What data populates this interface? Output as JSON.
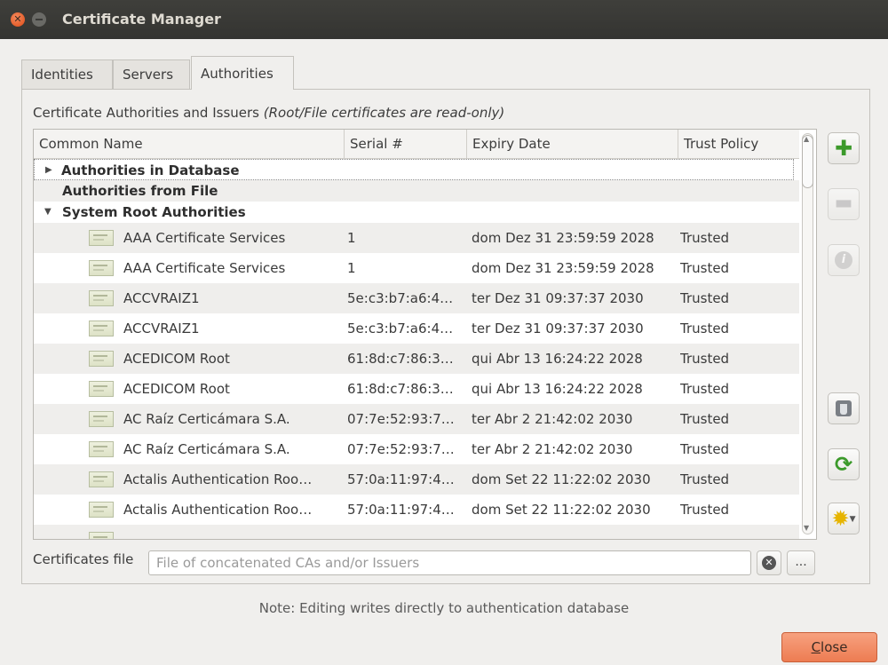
{
  "window": {
    "title": "Certificate Manager"
  },
  "tabs": [
    {
      "label": "Identities"
    },
    {
      "label": "Servers"
    },
    {
      "label": "Authorities"
    }
  ],
  "panel": {
    "caption": "Certificate Authorities and Issuers ",
    "caption_note": "(Root/File certificates are read-only)"
  },
  "columns": [
    "Common Name",
    "Serial #",
    "Expiry Date",
    "Trust Policy"
  ],
  "groups": {
    "database": "Authorities in Database",
    "file": "Authorities from File",
    "system": "System Root Authorities"
  },
  "rows": [
    {
      "name": "AAA Certificate Services",
      "serial": "1",
      "expiry": "dom Dez 31 23:59:59 2028",
      "trust": "Trusted"
    },
    {
      "name": "AAA Certificate Services",
      "serial": "1",
      "expiry": "dom Dez 31 23:59:59 2028",
      "trust": "Trusted"
    },
    {
      "name": "ACCVRAIZ1",
      "serial": "5e:c3:b7:a6:4…",
      "expiry": "ter Dez 31 09:37:37 2030",
      "trust": "Trusted"
    },
    {
      "name": "ACCVRAIZ1",
      "serial": "5e:c3:b7:a6:4…",
      "expiry": "ter Dez 31 09:37:37 2030",
      "trust": "Trusted"
    },
    {
      "name": "ACEDICOM Root",
      "serial": "61:8d:c7:86:3…",
      "expiry": "qui Abr 13 16:24:22 2028",
      "trust": "Trusted"
    },
    {
      "name": "ACEDICOM Root",
      "serial": "61:8d:c7:86:3…",
      "expiry": "qui Abr 13 16:24:22 2028",
      "trust": "Trusted"
    },
    {
      "name": "AC Raíz Certicámara S.A.",
      "serial": "07:7e:52:93:7…",
      "expiry": "ter Abr 2 21:42:02 2030",
      "trust": "Trusted"
    },
    {
      "name": "AC Raíz Certicámara S.A.",
      "serial": "07:7e:52:93:7…",
      "expiry": "ter Abr 2 21:42:02 2030",
      "trust": "Trusted"
    },
    {
      "name": "Actalis Authentication Roo…",
      "serial": "57:0a:11:97:4…",
      "expiry": "dom Set 22 11:22:02 2030",
      "trust": "Trusted"
    },
    {
      "name": "Actalis Authentication Roo…",
      "serial": "57:0a:11:97:4…",
      "expiry": "dom Set 22 11:22:02 2030",
      "trust": "Trusted"
    }
  ],
  "side_buttons": {
    "add": "plus-icon",
    "remove": "minus-icon",
    "info": "info-icon",
    "filter": "filter-icon",
    "refresh": "refresh-icon",
    "utilities": "gear-icon"
  },
  "file": {
    "label": "Certificates file",
    "placeholder": "File of concatenated CAs and/or Issuers",
    "value": "",
    "browse_label": "..."
  },
  "note": "Note: Editing writes directly to authentication database",
  "close_button": {
    "label_underlined": "C",
    "label_rest": "lose"
  },
  "colors": {
    "accent": "#ed7c52",
    "titlebar": "#3a3a37",
    "add_green": "#3c9a2b"
  }
}
